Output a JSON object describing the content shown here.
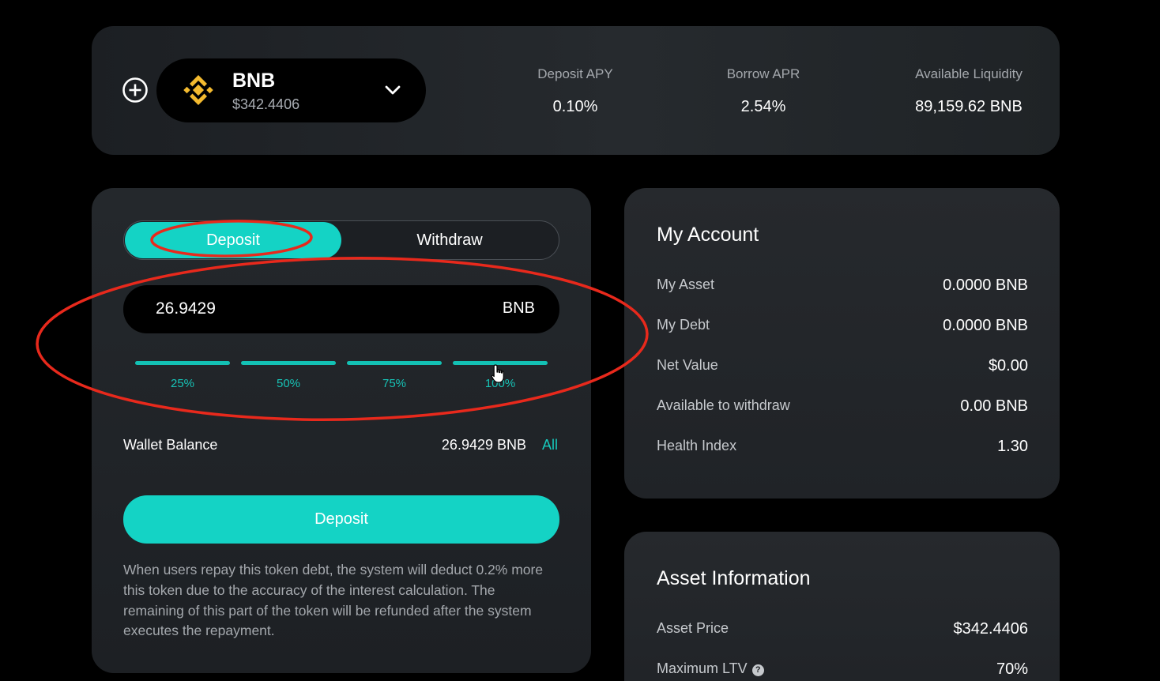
{
  "header": {
    "asset": {
      "symbol": "BNB",
      "price": "$342.4406"
    },
    "stats": {
      "deposit_apy": {
        "label": "Deposit APY",
        "value": "0.10%"
      },
      "borrow_apr": {
        "label": "Borrow APR",
        "value": "2.54%"
      },
      "available_liquidity": {
        "label": "Available Liquidity",
        "value": "89,159.62 BNB"
      }
    }
  },
  "form": {
    "tabs": {
      "deposit": "Deposit",
      "withdraw": "Withdraw"
    },
    "amount": {
      "value": "26.9429",
      "unit": "BNB"
    },
    "percentages": [
      "25%",
      "50%",
      "75%",
      "100%"
    ],
    "wallet": {
      "label": "Wallet Balance",
      "value": "26.9429 BNB",
      "all_label": "All"
    },
    "submit_label": "Deposit",
    "notice": "When users repay this token debt, the system will deduct 0.2% more this token due to the accuracy of the interest calculation. The remaining of this part of the token will be refunded after the system executes the repayment."
  },
  "account": {
    "title": "My Account",
    "rows": [
      {
        "label": "My Asset",
        "value": "0.0000 BNB"
      },
      {
        "label": "My Debt",
        "value": "0.0000 BNB"
      },
      {
        "label": "Net Value",
        "value": "$0.00"
      },
      {
        "label": "Available to withdraw",
        "value": "0.00 BNB"
      },
      {
        "label": "Health Index",
        "value": "1.30"
      }
    ]
  },
  "asset_info": {
    "title": "Asset Information",
    "rows": [
      {
        "label": "Asset Price",
        "value": "$342.4406"
      },
      {
        "label": "Maximum LTV",
        "value": "70%"
      }
    ]
  },
  "colors": {
    "accent": "#14d3c5",
    "bnb_yellow": "#f3ba2f",
    "annotation_red": "#e8291c"
  },
  "icons": {
    "add": "plus-circle-icon",
    "asset": "bnb-logo-icon",
    "dropdown": "chevron-down-icon",
    "cursor": "hand-pointer-icon",
    "help": "question-circle-icon"
  }
}
